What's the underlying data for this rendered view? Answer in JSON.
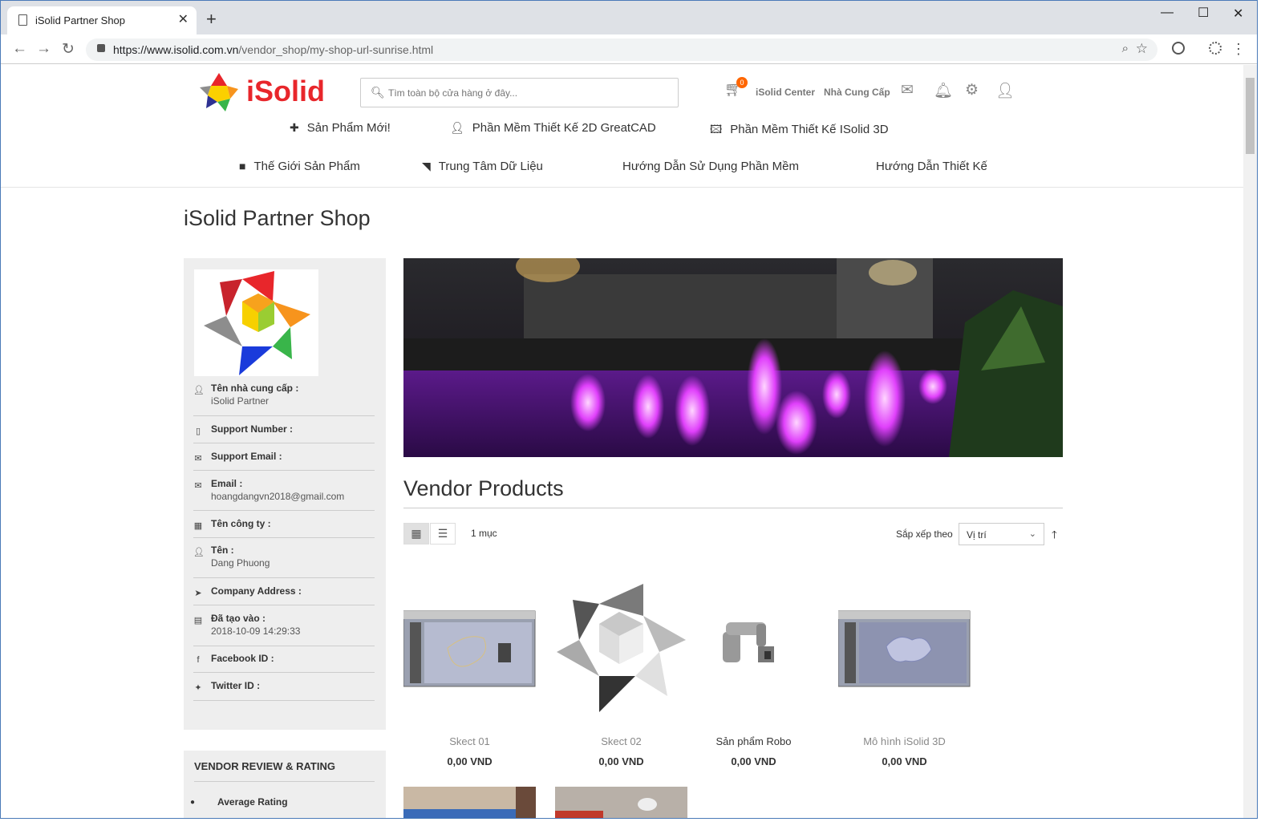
{
  "browser": {
    "tab_title": "iSolid Partner Shop",
    "url_host": "https://www.isolid.com.vn",
    "url_path": "/vendor_shop/my-shop-url-sunrise.html"
  },
  "header": {
    "logo_text": "iSolid",
    "search_placeholder": "Tìm toàn bộ cửa hàng ở đây...",
    "cart_count": "0",
    "center_link": "iSolid Center",
    "supplier_link": "Nhà Cung Cấp"
  },
  "nav_row1": [
    {
      "label": "Sản Phẩm Mới!",
      "icon": "plus-icon"
    },
    {
      "label": "Phần Mềm Thiết Kế 2D GreatCAD",
      "icon": "user-icon"
    },
    {
      "label": "Phần Mềm Thiết Kế ISolid 3D",
      "icon": "image-icon"
    }
  ],
  "nav_row2": [
    {
      "label": "Thế Giới Sản Phẩm",
      "icon": "video-icon"
    },
    {
      "label": "Trung Tâm Dữ Liệu",
      "icon": "rss-icon"
    },
    {
      "label": "Hướng Dẫn Sử Dụng Phần Mềm",
      "icon": ""
    },
    {
      "label": "Hướng Dẫn Thiết Kế",
      "icon": ""
    }
  ],
  "page_title": "iSolid Partner Shop",
  "vendor_info": [
    {
      "label": "Tên nhà cung cấp :",
      "value": "iSolid Partner",
      "icon": "user-icon"
    },
    {
      "label": "Support Number :",
      "value": "",
      "icon": "mobile-icon"
    },
    {
      "label": "Support Email :",
      "value": "",
      "icon": "envelope-icon"
    },
    {
      "label": "Email :",
      "value": "hoangdangvn2018@gmail.com",
      "icon": "envelope-icon"
    },
    {
      "label": "Tên công ty :",
      "value": "",
      "icon": "building-icon"
    },
    {
      "label": "Tên :",
      "value": "Dang Phuong",
      "icon": "user-icon"
    },
    {
      "label": "Company Address :",
      "value": "",
      "icon": "location-arrow-icon"
    },
    {
      "label": "Đã tạo vào :",
      "value": "2018-10-09 14:29:33",
      "icon": "calendar-icon"
    },
    {
      "label": "Facebook ID :",
      "value": "",
      "icon": "facebook-icon"
    },
    {
      "label": "Twitter ID :",
      "value": "",
      "icon": "twitter-icon"
    }
  ],
  "review": {
    "heading": "VENDOR REVIEW & RATING",
    "average_label": "Average Rating"
  },
  "products_section": {
    "title": "Vendor Products",
    "count_text": "1 mục",
    "sort_label": "Sắp xếp theo",
    "sort_value": "Vị trí"
  },
  "products": [
    {
      "name": "Skect 01",
      "price": "0,00 VND"
    },
    {
      "name": "Skect 02",
      "price": "0,00 VND"
    },
    {
      "name": "Sản phẩm Robo",
      "price": "0,00 VND"
    },
    {
      "name": "Mô hình iSolid 3D",
      "price": "0,00 VND"
    }
  ]
}
